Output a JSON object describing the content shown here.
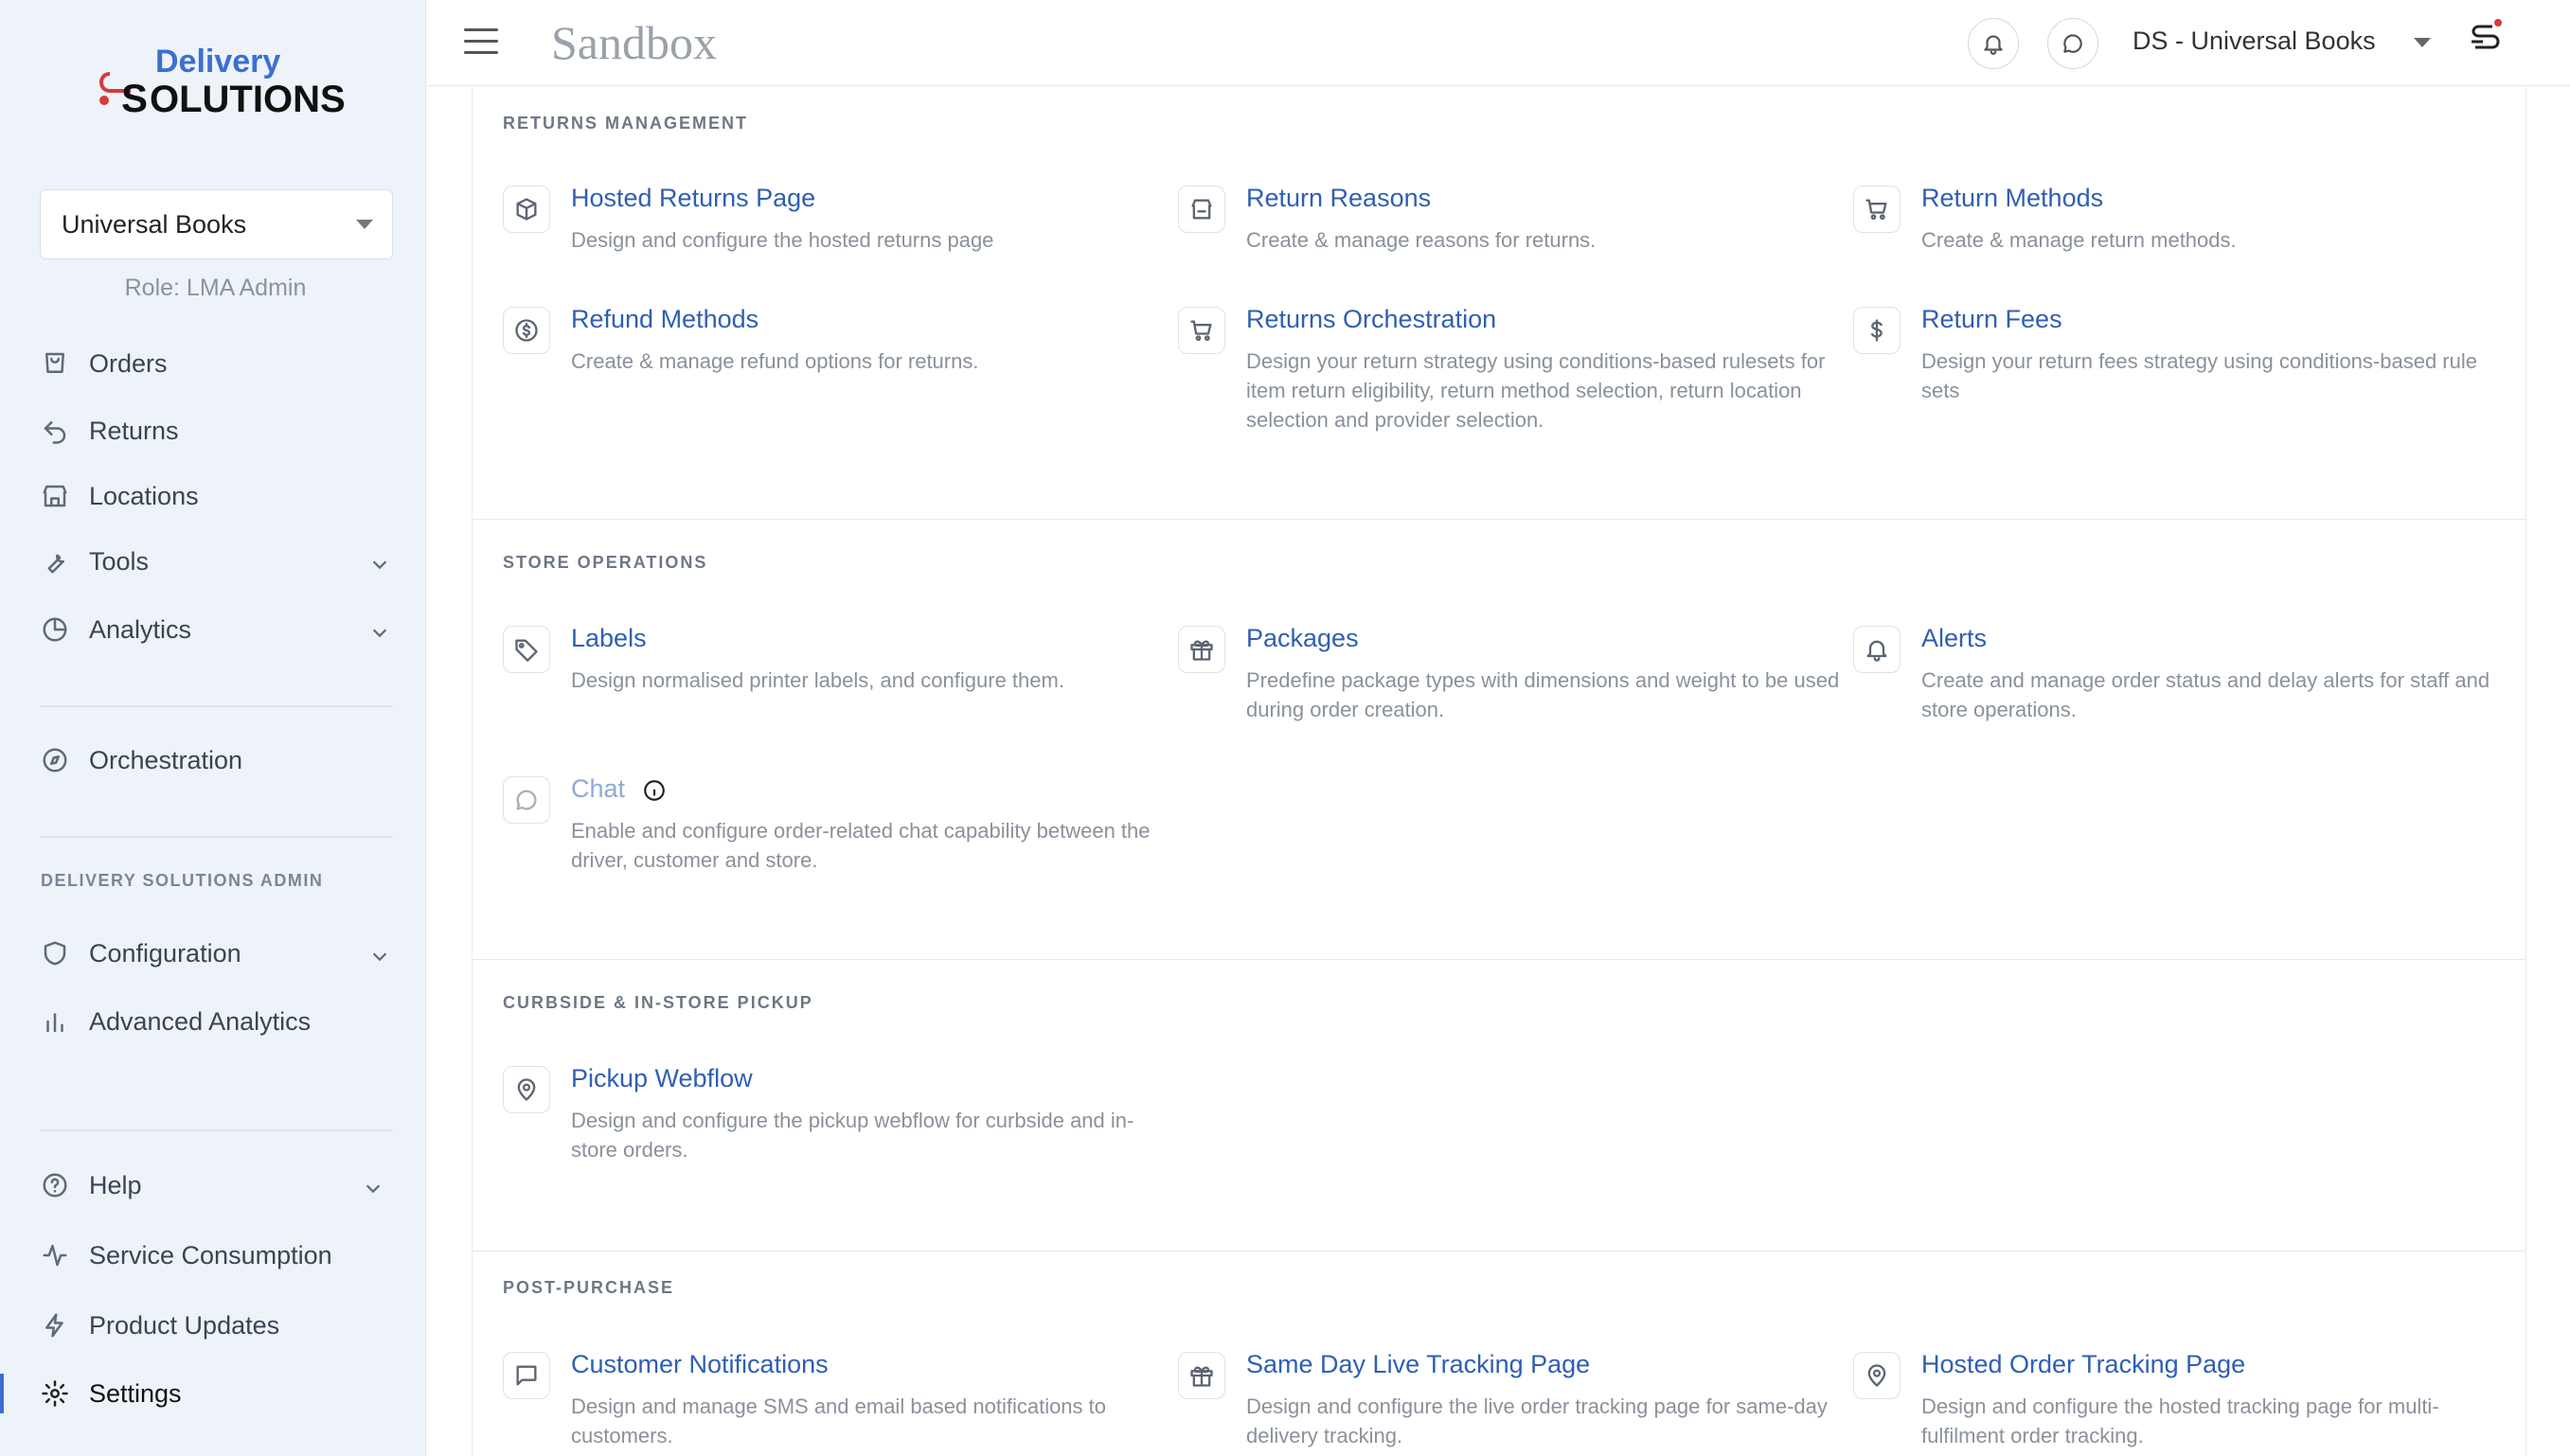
{
  "brand": {
    "line1": "Delivery",
    "line2": "OLUTIONS",
    "initial": "S"
  },
  "org_select": {
    "value": "Universal Books"
  },
  "role_text": "Role: LMA Admin",
  "sidebar": {
    "items": [
      {
        "label": "Orders",
        "icon": "cart-icon"
      },
      {
        "label": "Returns",
        "icon": "return-arrow-icon"
      },
      {
        "label": "Locations",
        "icon": "store-icon"
      },
      {
        "label": "Tools",
        "icon": "wrench-icon"
      },
      {
        "label": "Analytics",
        "icon": "pie-chart-icon"
      },
      {
        "label": "Orchestration",
        "icon": "compass-icon"
      },
      {
        "label": "Configuration",
        "icon": "shield-icon"
      },
      {
        "label": "Advanced Analytics",
        "icon": "bar-chart-icon"
      },
      {
        "label": "Help",
        "icon": "help-icon"
      },
      {
        "label": "Service Consumption",
        "icon": "activity-icon"
      },
      {
        "label": "Product Updates",
        "icon": "lightning-icon"
      },
      {
        "label": "Settings",
        "icon": "gear-icon",
        "active": true
      }
    ],
    "admin_section_label": "DELIVERY SOLUTIONS ADMIN"
  },
  "topbar": {
    "environment": "Sandbox",
    "account": "DS - Universal Books"
  },
  "sections": {
    "returns": {
      "title": "RETURNS MANAGEMENT",
      "cards": [
        {
          "title": "Hosted Returns Page",
          "desc": "Design and configure the hosted returns page",
          "icon": "package-return-icon"
        },
        {
          "title": "Return Reasons",
          "desc": "Create & manage reasons for returns.",
          "icon": "store-return-icon"
        },
        {
          "title": "Return Methods",
          "desc": "Create & manage return methods.",
          "icon": "cart-icon"
        },
        {
          "title": "Refund Methods",
          "desc": "Create & manage refund options for returns.",
          "icon": "refund-coin-icon"
        },
        {
          "title": "Returns Orchestration",
          "desc": "Design your return strategy using conditions-based rulesets for item return eligibility, return method selection, return location selection and provider selection.",
          "icon": "cart-icon"
        },
        {
          "title": "Return Fees",
          "desc": "Design your return fees strategy using conditions-based rule sets",
          "icon": "dollar-icon"
        }
      ]
    },
    "store": {
      "title": "STORE OPERATIONS",
      "cards": [
        {
          "title": "Labels",
          "desc": "Design normalised printer labels, and configure them.",
          "icon": "tag-icon"
        },
        {
          "title": "Packages",
          "desc": "Predefine package types with dimensions and weight to be used during order creation.",
          "icon": "gift-icon"
        },
        {
          "title": "Alerts",
          "desc": "Create and manage order status and delay alerts for staff and store operations.",
          "icon": "bell-icon"
        },
        {
          "title": "Chat",
          "desc": "Enable and configure order-related chat capability between the driver, customer and store.",
          "icon": "chat-icon"
        }
      ]
    },
    "pickup": {
      "title": "CURBSIDE & IN-STORE PICKUP",
      "cards": [
        {
          "title": "Pickup Webflow",
          "desc": "Design and configure the pickup webflow for curbside and in-store orders.",
          "icon": "map-pin-icon"
        }
      ]
    },
    "post": {
      "title": "POST-PURCHASE",
      "cards": [
        {
          "title": "Customer Notifications",
          "desc": "Design and manage SMS and email based notifications to customers.",
          "icon": "message-icon"
        },
        {
          "title": "Same Day Live Tracking Page",
          "desc": "Design and configure the live order tracking page for same-day delivery tracking.",
          "icon": "gift-icon"
        },
        {
          "title": "Hosted Order Tracking Page",
          "desc": "Design and configure the hosted tracking page for multi-fulfilment order tracking.",
          "icon": "map-pin-icon"
        }
      ]
    }
  }
}
